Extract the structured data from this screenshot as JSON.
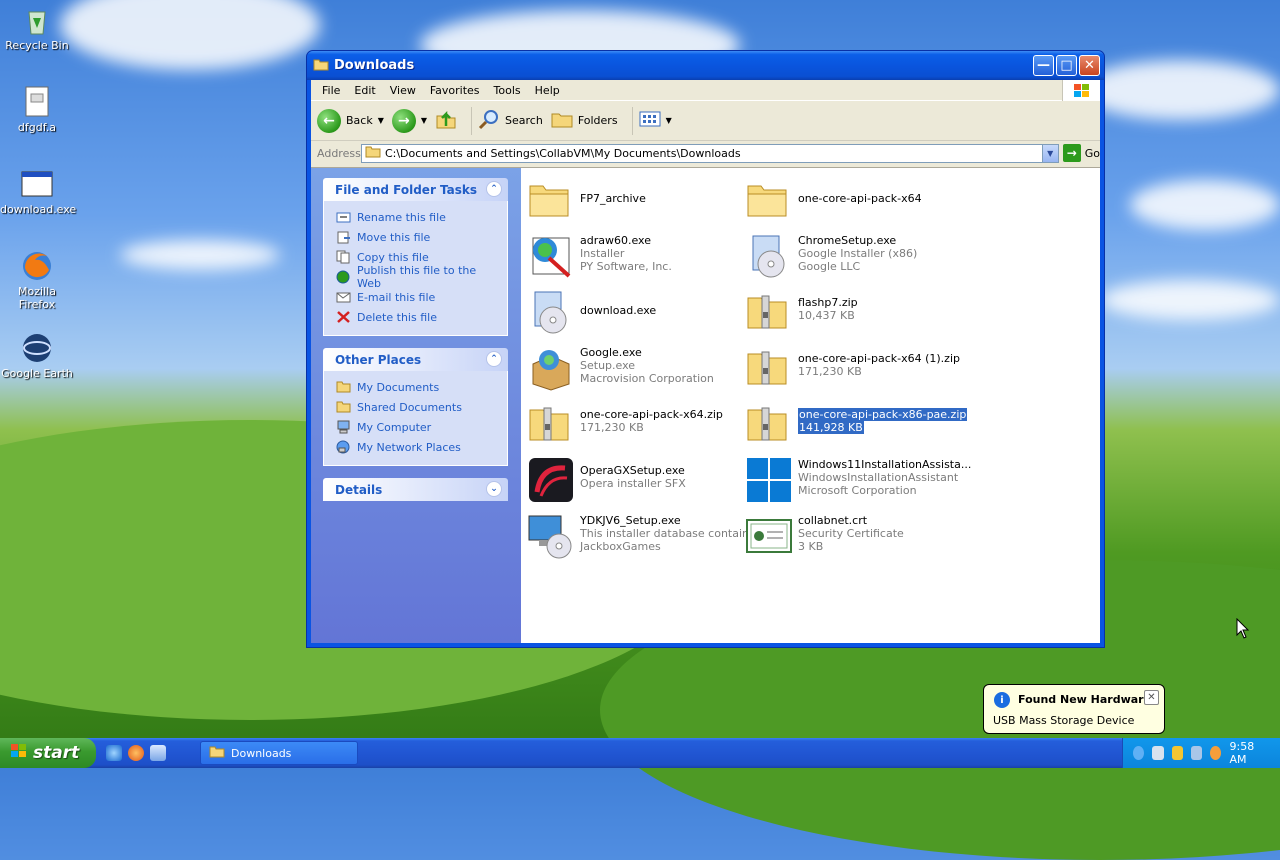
{
  "desktop": {
    "icons": [
      {
        "label": "Recycle Bin",
        "icon": "recycle-bin-icon"
      },
      {
        "label": "dfgdf.a",
        "icon": "document-icon"
      },
      {
        "label": "download.exe",
        "icon": "application-icon"
      },
      {
        "label": "Mozilla Firefox",
        "icon": "firefox-icon"
      },
      {
        "label": "Google Earth",
        "icon": "google-earth-icon"
      }
    ]
  },
  "window": {
    "title": "Downloads",
    "menu": [
      "File",
      "Edit",
      "View",
      "Favorites",
      "Tools",
      "Help"
    ],
    "toolbar": {
      "back": "Back",
      "search": "Search",
      "folders": "Folders"
    },
    "address": {
      "label": "Address",
      "path": "C:\\Documents and Settings\\CollabVM\\My Documents\\Downloads",
      "go": "Go"
    }
  },
  "tasks_panel": {
    "title": "File and Folder Tasks",
    "items": [
      "Rename this file",
      "Move this file",
      "Copy this file",
      "Publish this file to the Web",
      "E-mail this file",
      "Delete this file"
    ]
  },
  "places_panel": {
    "title": "Other Places",
    "items": [
      "My Documents",
      "Shared Documents",
      "My Computer",
      "My Network Places"
    ]
  },
  "details_panel": {
    "title": "Details"
  },
  "files": [
    {
      "name": "FP7_archive",
      "line2": "",
      "line3": "",
      "icon": "folder-icon"
    },
    {
      "name": "one-core-api-pack-x64",
      "line2": "",
      "line3": "",
      "icon": "folder-icon"
    },
    {
      "name": "adraw60.exe",
      "line2": "Installer",
      "line3": "PY Software, Inc.",
      "icon": "installer-icon"
    },
    {
      "name": "ChromeSetup.exe",
      "line2": "Google Installer (x86)",
      "line3": "Google LLC",
      "icon": "setup-icon"
    },
    {
      "name": "download.exe",
      "line2": "",
      "line3": "",
      "icon": "setup-icon"
    },
    {
      "name": "flashp7.zip",
      "line2": "10,437 KB",
      "line3": "",
      "icon": "zip-folder-icon"
    },
    {
      "name": "Google.exe",
      "line2": "Setup.exe",
      "line3": "Macrovision Corporation",
      "icon": "package-icon"
    },
    {
      "name": "one-core-api-pack-x64 (1).zip",
      "line2": "171,230 KB",
      "line3": "",
      "icon": "zip-folder-icon"
    },
    {
      "name": "one-core-api-pack-x64.zip",
      "line2": "171,230 KB",
      "line3": "",
      "icon": "zip-folder-icon"
    },
    {
      "name": "one-core-api-pack-x86-pae.zip",
      "line2": "141,928 KB",
      "line3": "",
      "icon": "zip-folder-icon",
      "selected": true
    },
    {
      "name": "OperaGXSetup.exe",
      "line2": "Opera installer SFX",
      "line3": "",
      "icon": "opera-gx-icon"
    },
    {
      "name": "Windows11InstallationAssista...",
      "line2": "WindowsInstallationAssistant",
      "line3": "Microsoft Corporation",
      "icon": "windows-logo-icon"
    },
    {
      "name": "YDKJV6_Setup.exe",
      "line2": "This installer database contain...",
      "line3": "JackboxGames",
      "icon": "monitor-cd-icon"
    },
    {
      "name": "collabnet.crt",
      "line2": "Security Certificate",
      "line3": "3 KB",
      "icon": "certificate-icon"
    }
  ],
  "balloon": {
    "title": "Found New Hardware",
    "body": "USB Mass Storage Device"
  },
  "taskbar": {
    "start": "start",
    "task": "Downloads",
    "clock": "9:58 AM"
  },
  "colors": {
    "selection": "#316ac5",
    "link": "#215dc6",
    "titlebar": "#0a55de"
  }
}
